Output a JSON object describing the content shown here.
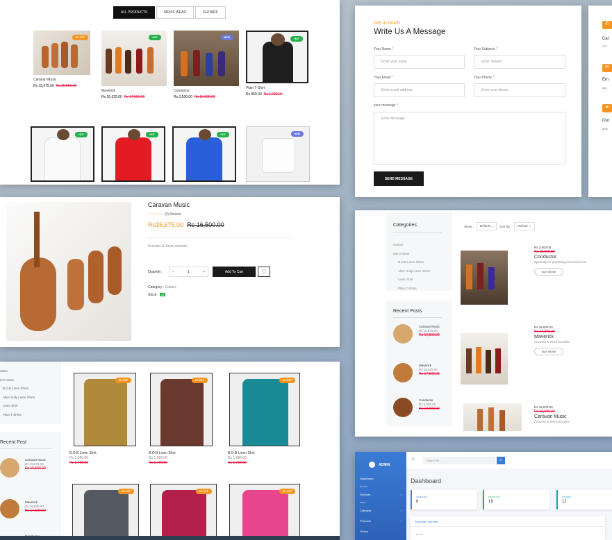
{
  "shop": {
    "tabs": [
      "ALL PRODUCTS",
      "MEN'S WEAR",
      "GUITARS"
    ],
    "products": [
      {
        "name": "Caravan Music",
        "price": "Rs 15,675.00",
        "old": "Rs 16,500.00",
        "badge": "8% OFF"
      },
      {
        "name": "Maverick",
        "price": "Rs 16,625.00",
        "old": "Rs 17,500.00",
        "badge": "HOT"
      },
      {
        "name": "Conductor",
        "price": "Rs 3,500.00",
        "old": "Rs 10,000.00",
        "badge": "NEW"
      },
      {
        "name": "Plain T-Shirt",
        "price": "Rs 950.00",
        "old": "Rs 1,000.00",
        "badge": "HOT"
      }
    ],
    "row2_badges": [
      "HOT",
      "HOT",
      "HOT",
      "NEW"
    ]
  },
  "contact": {
    "eyebrow": "Get in touch",
    "title": "Write Us A Message",
    "name_label": "Your Name",
    "name_ph": "Enter your name",
    "subject_label": "Your Subjects",
    "subject_ph": "Enter Subject",
    "email_label": "Your Email",
    "email_ph": "Enter email address",
    "phone_label": "Your Phone",
    "phone_ph": "Enter your phone",
    "msg_label": "your message",
    "msg_ph": "Enter Message",
    "send": "SEND MESSAGE",
    "req": "*",
    "side": [
      "Cal",
      "075",
      "Em",
      "glla",
      "Our",
      "Mab"
    ]
  },
  "detail": {
    "title": "Caravan Music",
    "stars": "☆☆☆☆☆",
    "review": "(0) Review",
    "price": "Rs15,675.00",
    "old": "Rs 16,500.00",
    "type": "Acoustic & Semi-acoustic",
    "qty_label": "Quantity :",
    "qty": "1",
    "minus": "−",
    "plus": "+",
    "add": "Add To Cart",
    "category_label": "Category :",
    "category": "Guitars",
    "stock_label": "Stock :",
    "stock": "30"
  },
  "listing": {
    "cat_title": "Categories",
    "show": "Show :",
    "show_val": "Default",
    "sort": "Sort By :",
    "sort_val": "Default",
    "cats": [
      "Guitars",
      "Men's Wear",
      "B.O.B Linen Shirts",
      "Allen Solly Linen Shirts",
      "Linen Shirt",
      "Plain T-Shirts"
    ],
    "recent_title": "Recent Posts",
    "recent": [
      {
        "name": "Caravan Music",
        "price": "Rs 15,675.00",
        "old": "Rs 16,500.00"
      },
      {
        "name": "Maverick",
        "price": "Rs 16,625.00",
        "old": "Rs 17,500.00"
      },
      {
        "name": "Conductor",
        "price": "Rs 3,500.00",
        "old": "Rs 10,000.00"
      }
    ],
    "items": [
      {
        "price": "Rs 3,500.00",
        "old": "Rs 10,000.00",
        "name": "Conductor",
        "desc": "Specially for practicing and school stu",
        "btn": "BUY NOW!"
      },
      {
        "price": "Rs 16,625.00",
        "old": "Rs 17,500.00",
        "name": "Maverick",
        "desc": "Acoustic & Semi-acoustic",
        "btn": "BUY NOW!"
      },
      {
        "price": "Rs 15,675.00",
        "old": "Rs 16,500.00",
        "name": "Caravan Music",
        "desc": "Acoustic & Semi-acoustic"
      }
    ]
  },
  "shirts": {
    "cats": [
      "uitars",
      "en's Wear",
      "B.O.B Linen Shirts",
      "Allen Solly Linen Shirts",
      "Linen Shirt",
      "Plain T-Shirts"
    ],
    "recent_title": "Recent Post",
    "recent": [
      {
        "name": "Caravan Music",
        "price": "Rs 15,675.00",
        "old": "Rs 16,500.00"
      },
      {
        "name": "Maverick",
        "price": "Rs 16,625.00",
        "old": "Rs 17,500.00"
      },
      {
        "name": "Conductor"
      }
    ],
    "items": [
      {
        "name": "B.O.B Linen Shirt",
        "price": "Rs 1,666.00",
        "old": "Rs 1,700.00",
        "badge": "2% OFF"
      },
      {
        "name": "B.O.B Linen Shirt",
        "price": "Rs 1,666.00",
        "old": "Rs 1,700.00",
        "badge": "2% OFF"
      },
      {
        "name": "B.O.B Linen Shirt",
        "price": "Rs 1,666.00",
        "old": "Rs 1,700.00",
        "badge": "2% OFF"
      }
    ],
    "row2_badge": "2% OFF"
  },
  "admin": {
    "brand": "ADMIN",
    "search_ph": "Search for...",
    "page": "Dashboard",
    "nav": [
      "Dashboard",
      "Services",
      "Category",
      "Products",
      "Orders"
    ],
    "sections": [
      "BILLING",
      "SHOP"
    ],
    "cards": [
      {
        "label": "CATEGORY",
        "value": "6"
      },
      {
        "label": "PRODUCTS",
        "value": "19"
      },
      {
        "label": "ORDERS",
        "value": "12"
      }
    ],
    "earnings": "Earnings Overview",
    "earnings_sub": "£5,000"
  },
  "colors": {
    "accent": "#f7941d",
    "hot": "#22b14c",
    "new": "#6c7ae0",
    "sale": "#e03",
    "admin_blue": "#3a7bd5"
  }
}
